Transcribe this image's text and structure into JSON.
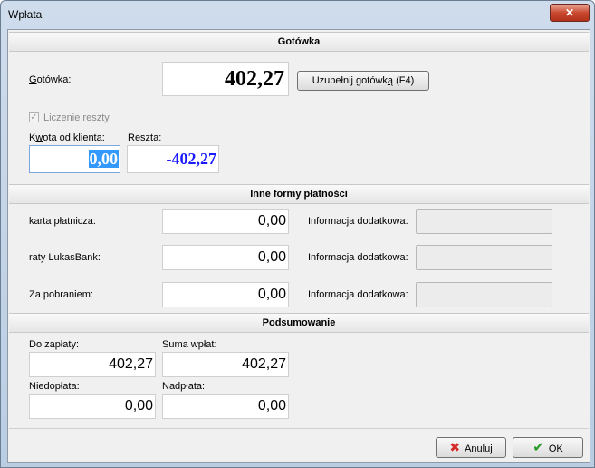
{
  "window": {
    "title": "Wpłata",
    "close_glyph": "✕"
  },
  "cash": {
    "header": "Gotówka",
    "label": "Gotówka:",
    "value": "402,27",
    "fill_button": "Uzupełnij gotówką (F4)",
    "change_checkbox": {
      "label": "Liczenie reszty",
      "checked": true,
      "check_glyph": "✓"
    },
    "client_amount": {
      "label": "Kwota od klienta:",
      "value": "0,00"
    },
    "change": {
      "label": "Reszta:",
      "value": "-402,27"
    }
  },
  "other": {
    "header": "Inne formy płatności",
    "rows": [
      {
        "label": "karta płatnicza:",
        "value": "0,00",
        "info_label": "Informacja dodatkowa:",
        "info_value": ""
      },
      {
        "label": "raty LukasBank:",
        "value": "0,00",
        "info_label": "Informacja dodatkowa:",
        "info_value": ""
      },
      {
        "label": "Za pobraniem:",
        "value": "0,00",
        "info_label": "Informacja dodatkowa:",
        "info_value": ""
      }
    ]
  },
  "summary": {
    "header": "Podsumowanie",
    "to_pay": {
      "label": "Do zapłaty:",
      "value": "402,27"
    },
    "sum_paid": {
      "label": "Suma wpłat:",
      "value": "402,27"
    },
    "underpaid": {
      "label": "Niedopłata:",
      "value": "0,00"
    },
    "overpaid": {
      "label": "Nadpłata:",
      "value": "0,00"
    }
  },
  "buttons": {
    "cancel": {
      "label": "Anuluj",
      "icon_glyph": "✖"
    },
    "ok": {
      "label": "OK",
      "icon_glyph": "✔"
    }
  },
  "colors": {
    "accent_blue": "#1a1aff",
    "cancel_red": "#d62b2b",
    "ok_green": "#2a9b2a",
    "selection": "#3399ff"
  }
}
